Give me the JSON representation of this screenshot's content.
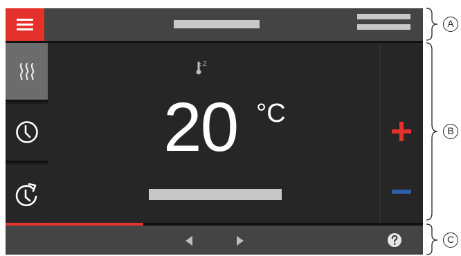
{
  "main": {
    "sensor_index": "2",
    "temperature_value": "20",
    "temperature_unit": "°C"
  },
  "progress": {
    "fraction": 0.33
  },
  "callouts": {
    "a": "A",
    "b": "B",
    "c": "C"
  },
  "icons": {
    "menu": "hamburger-icon",
    "heating": "heating-waves-icon",
    "clock": "clock-icon",
    "clock_repeat": "clock-refresh-icon",
    "thermometer": "thermometer-icon",
    "increase": "plus-icon",
    "decrease": "minus-icon",
    "prev": "triangle-left-icon",
    "next": "triangle-right-icon",
    "help": "question-mark-icon"
  },
  "colors": {
    "accent": "#e4312b",
    "decrease": "#2e5fa8",
    "background": "#2f2f2f",
    "bar": "#444444",
    "placeholder": "#c8c8c8"
  }
}
